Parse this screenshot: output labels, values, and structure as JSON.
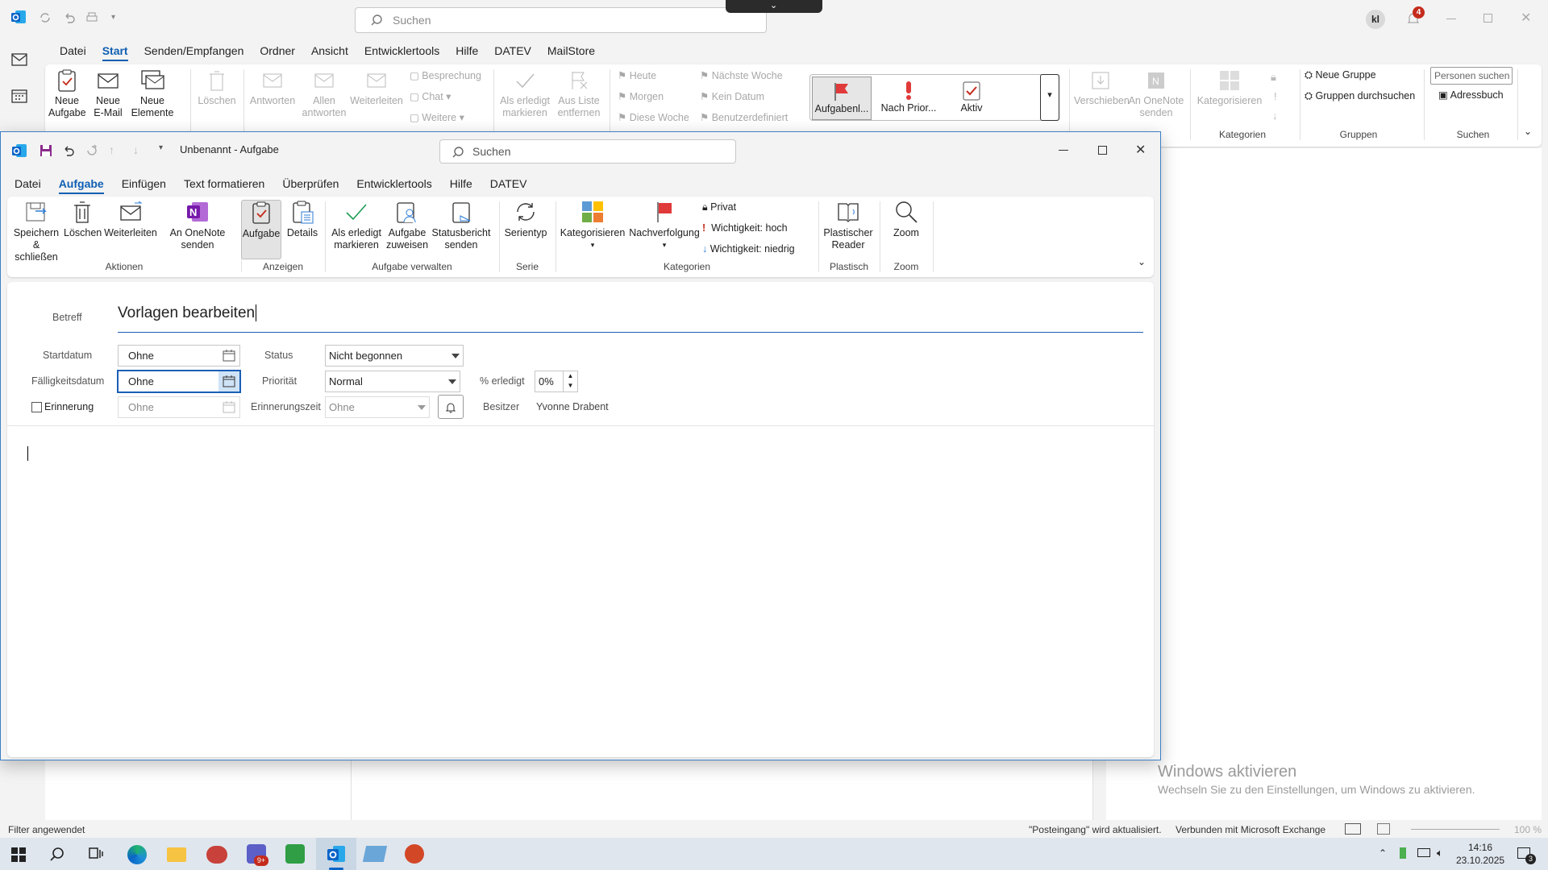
{
  "main_window": {
    "search_placeholder": "Suchen",
    "user_initials": "kl",
    "notification_count": "4",
    "menu": [
      "Datei",
      "Start",
      "Senden/Empfangen",
      "Ordner",
      "Ansicht",
      "Entwicklertools",
      "Hilfe",
      "DATEV",
      "MailStore"
    ],
    "active_menu": "Start",
    "ribbon": {
      "new_task": "Neue Aufgabe",
      "new_email": "Neue E-Mail",
      "new_items": "Neue Elemente",
      "delete": "Löschen",
      "reply": "Antworten",
      "reply_all": "Allen antworten",
      "forward": "Weiterleiten",
      "meeting": "Besprechung",
      "chat": "Chat",
      "more": "Weitere",
      "mark_complete": "Als erledigt markieren",
      "remove_from_list": "Aus Liste entfernen",
      "today": "Heute",
      "tomorrow": "Morgen",
      "this_week": "Diese Woche",
      "next_week": "Nächste Woche",
      "no_date": "Kein Datum",
      "custom": "Benutzerdefiniert",
      "view1": "Aufgabenl...",
      "view2": "Nach Prior...",
      "view3": "Aktiv",
      "move": "Verschieben",
      "onenote": "An OneNote senden",
      "categorize": "Kategorisieren",
      "group_categories": "Kategorien",
      "new_group": "Neue Gruppe",
      "search_groups": "Gruppen durchsuchen",
      "group_groups": "Gruppen",
      "search_people": "Personen suchen",
      "address_book": "Adressbuch",
      "group_search": "Suchen"
    },
    "watermark_title": "Windows aktivieren",
    "watermark_text": "Wechseln Sie zu den Einstellungen, um Windows zu aktivieren.",
    "status_left": "Filter angewendet",
    "status_update": "\"Posteingang\" wird aktualisiert.",
    "status_connection": "Verbunden mit Microsoft Exchange",
    "zoom": "100 %"
  },
  "task_window": {
    "title": "Unbenannt  -  Aufgabe",
    "search_placeholder": "Suchen",
    "menu": [
      "Datei",
      "Aufgabe",
      "Einfügen",
      "Text formatieren",
      "Überprüfen",
      "Entwicklertools",
      "Hilfe",
      "DATEV"
    ],
    "active_menu": "Aufgabe",
    "ribbon": {
      "save_close": "Speichern & schließen",
      "delete": "Löschen",
      "forward": "Weiterleiten",
      "onenote": "An OneNote senden",
      "group_actions": "Aktionen",
      "task": "Aufgabe",
      "details": "Details",
      "group_show": "Anzeigen",
      "mark_complete": "Als erledigt markieren",
      "assign_task": "Aufgabe zuweisen",
      "status_report": "Statusbericht senden",
      "group_manage": "Aufgabe verwalten",
      "recurrence": "Serientyp",
      "group_series": "Serie",
      "categorize": "Kategorisieren",
      "follow_up": "Nachverfolgung",
      "private": "Privat",
      "high_importance": "Wichtigkeit: hoch",
      "low_importance": "Wichtigkeit: niedrig",
      "group_tags": "Kategorien",
      "immersive_reader": "Plastischer Reader",
      "group_immersive": "Plastisch",
      "zoom": "Zoom",
      "group_zoom": "Zoom"
    },
    "form": {
      "subject_label": "Betreff",
      "subject_value": "Vorlagen bearbeiten",
      "start_label": "Startdatum",
      "start_value": "Ohne",
      "due_label": "Fälligkeitsdatum",
      "due_value": "Ohne",
      "reminder_label": "Erinnerung",
      "reminder_date": "Ohne",
      "status_label": "Status",
      "status_value": "Nicht begonnen",
      "priority_label": "Priorität",
      "priority_value": "Normal",
      "percent_label": "% erledigt",
      "percent_value": "0%",
      "reminder_time_label": "Erinnerungszeit",
      "reminder_time_value": "Ohne",
      "owner_label": "Besitzer",
      "owner_value": "Yvonne Drabent"
    }
  },
  "taskbar": {
    "time": "14:16",
    "date": "23.10.2025",
    "teams_badge": "9+",
    "notification_count": "3"
  },
  "colors": {
    "accent": "#0f5fb3",
    "outlook_blue": "#0a64c8",
    "window_border": "#3c7fc6",
    "badge_red": "#c42b1c"
  }
}
